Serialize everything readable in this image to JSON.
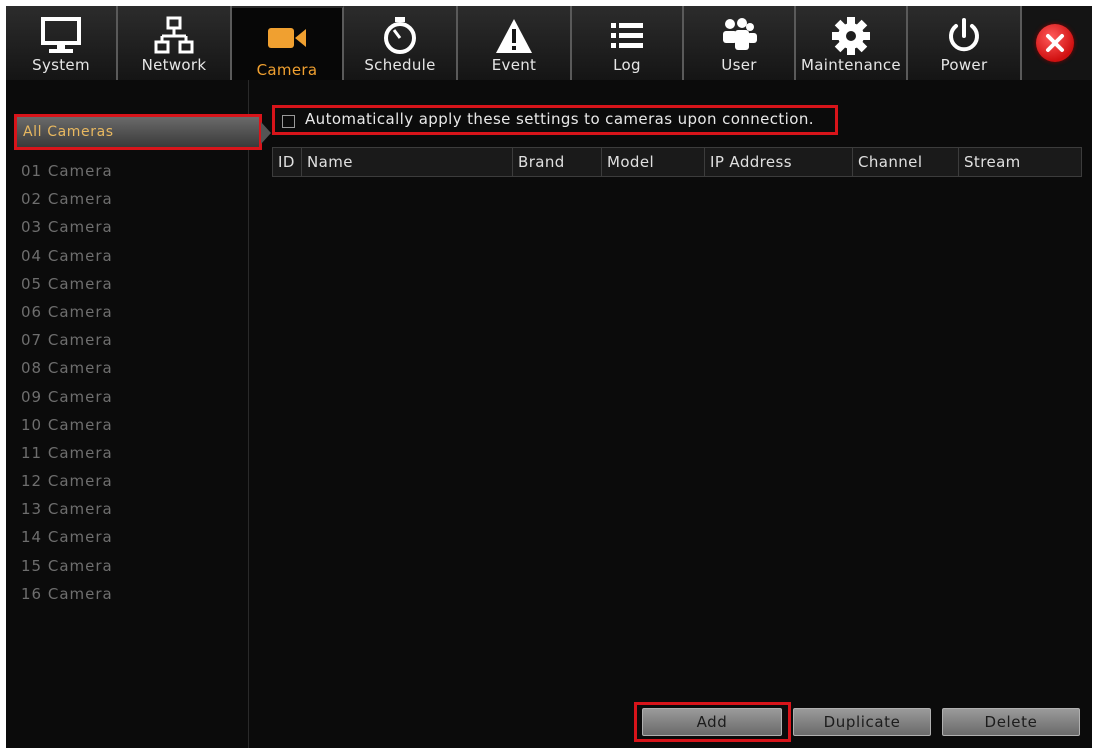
{
  "toolbar": {
    "tabs": [
      {
        "label": "System",
        "icon": "monitor-icon"
      },
      {
        "label": "Network",
        "icon": "network-icon"
      },
      {
        "label": "Camera",
        "icon": "camera-icon",
        "active": true
      },
      {
        "label": "Schedule",
        "icon": "stopwatch-icon"
      },
      {
        "label": "Event",
        "icon": "warning-icon"
      },
      {
        "label": "Log",
        "icon": "list-icon"
      },
      {
        "label": "User",
        "icon": "users-icon"
      },
      {
        "label": "Maintenance",
        "icon": "gear-icon"
      },
      {
        "label": "Power",
        "icon": "power-icon"
      }
    ],
    "close_icon": "close-icon"
  },
  "sidebar": {
    "all_cameras": "All Cameras",
    "cameras": [
      "01 Camera",
      "02 Camera",
      "03 Camera",
      "04 Camera",
      "05 Camera",
      "06 Camera",
      "07 Camera",
      "08 Camera",
      "09 Camera",
      "10 Camera",
      "11 Camera",
      "12 Camera",
      "13 Camera",
      "14 Camera",
      "15 Camera",
      "16 Camera"
    ]
  },
  "main": {
    "auto_apply_label": "Automatically apply these settings to cameras upon connection.",
    "auto_apply_checked": false,
    "table": {
      "columns": [
        "ID",
        "Name",
        "Brand",
        "Model",
        "IP Address",
        "Channel",
        "Stream"
      ],
      "rows": []
    },
    "buttons": {
      "add": "Add",
      "duplicate": "Duplicate",
      "delete": "Delete"
    }
  },
  "colors": {
    "accent": "#f0a030",
    "highlight": "#d8141a",
    "background": "#0b0b0b"
  }
}
